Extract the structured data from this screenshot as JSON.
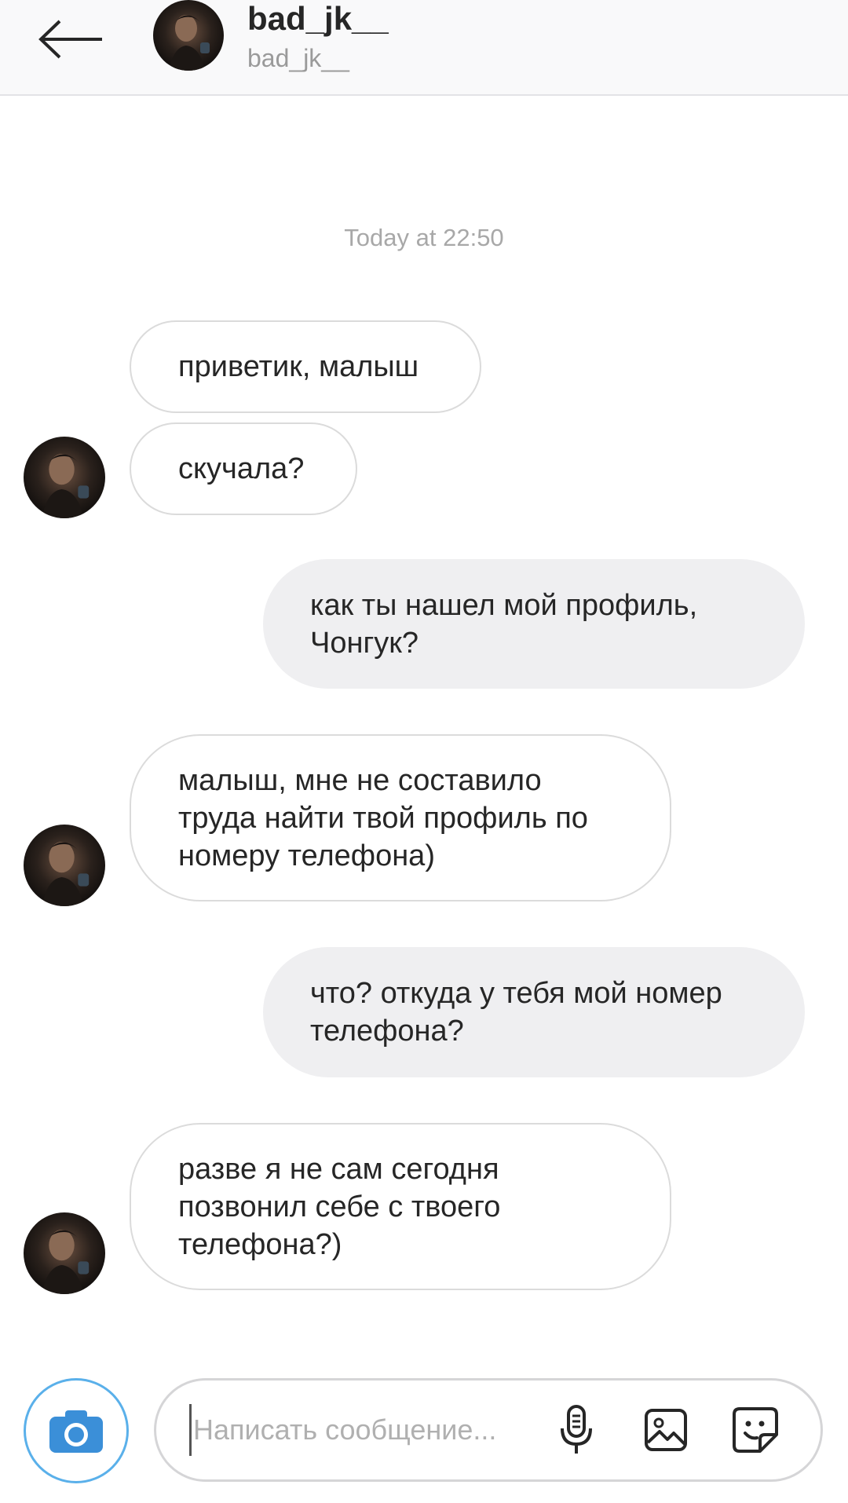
{
  "header": {
    "name": "bad_jk__",
    "username": "bad_jk__"
  },
  "chat": {
    "timestamp": "Today at 22:50",
    "messages": [
      {
        "direction": "incoming",
        "lines": [
          "приветик, малыш"
        ]
      },
      {
        "direction": "incoming",
        "lines": [
          "скучала?"
        ]
      },
      {
        "direction": "outgoing",
        "lines": [
          "как ты нашел мой профиль,",
          "Чонгук?"
        ]
      },
      {
        "direction": "incoming",
        "lines": [
          "малыш, мне не составило",
          "труда найти твой профиль по",
          "номеру телефона)"
        ]
      },
      {
        "direction": "outgoing",
        "lines": [
          "что? откуда у тебя мой номер",
          "телефона?"
        ]
      },
      {
        "direction": "incoming",
        "lines": [
          "разве я не сам сегодня",
          "позвонил себе с твоего",
          "телефона?)"
        ]
      }
    ]
  },
  "composer": {
    "placeholder": "Написать сообщение...",
    "value": ""
  },
  "icons": {
    "back": "arrow-left-icon",
    "camera": "camera-icon",
    "mic": "microphone-icon",
    "gallery": "image-icon",
    "sticker": "sticker-icon"
  },
  "colors": {
    "camera_accent": "#3b8fd8",
    "outgoing_bubble": "#efeff1",
    "incoming_border": "#dbdbdb"
  }
}
